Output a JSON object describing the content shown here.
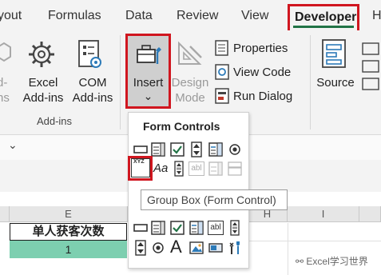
{
  "tabs": [
    "yout",
    "Formulas",
    "Data",
    "Review",
    "View"
  ],
  "active_tab": "Developer",
  "tab_partial": "H",
  "ribbon": {
    "addins_partial_1": "d-",
    "addins_partial_2": "ns",
    "excel_addins": [
      "Excel",
      "Add-ins"
    ],
    "com_addins": [
      "COM",
      "Add-ins"
    ],
    "addins_group": "Add-ins",
    "insert": "Insert",
    "insert_chevron": "⌄",
    "design_mode": [
      "Design",
      "Mode"
    ],
    "properties": "Properties",
    "view_code": "View Code",
    "run_dialog": "Run Dialog",
    "source": "Source"
  },
  "formula_bar": {
    "chevron": "⌄"
  },
  "dropdown": {
    "title": "Form Controls"
  },
  "tooltip": "Group Box (Form Control)",
  "columns": {
    "e": "E",
    "h": "H",
    "i": "I"
  },
  "cells": {
    "e2": "单人获客次数",
    "e3": "1"
  },
  "watermark": "Excel学习世界",
  "icon_text": {
    "aa": "Aa",
    "abl": "abl",
    "xyz": "XYZ",
    "a": "A"
  },
  "colors": {
    "highlight": "#d0161f",
    "accent": "#217346",
    "cell_fill": "#7dcfb0"
  }
}
